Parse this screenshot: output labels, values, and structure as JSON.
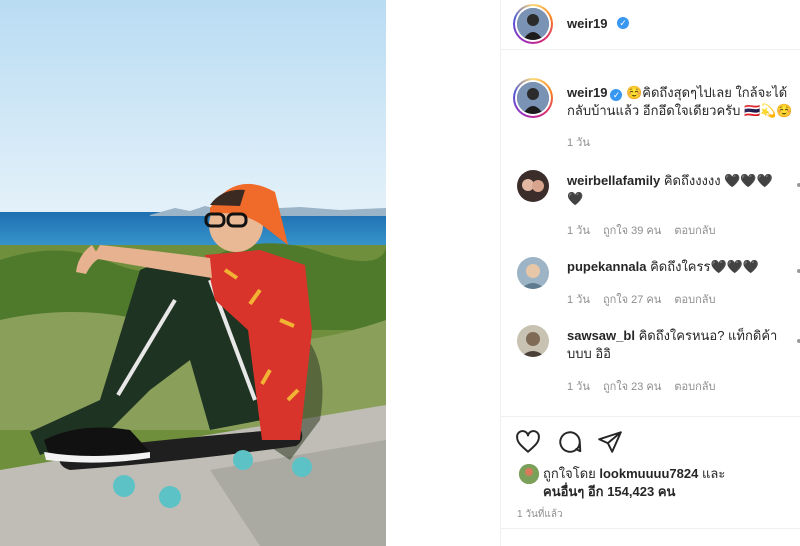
{
  "post": {
    "username": "weir19",
    "verified_icon": "verified-badge-icon"
  },
  "caption": {
    "username": "weir19",
    "text": "☺️คิดถึงสุดๆไปเลย ใกล้จะได้กลับบ้านแล้ว อีกอึดใจเดียวครับ 🇹🇭💫☺️",
    "time": "1 วัน"
  },
  "comments": [
    {
      "username": "weirbellafamily",
      "text": "คิดถึงงงงง 🖤🖤🖤🖤",
      "time": "1 วัน",
      "likes": "ถูกใจ 39 คน",
      "reply": "ตอบกลับ"
    },
    {
      "username": "pupekannala",
      "text": "คิดถึงใครร🖤🖤🖤",
      "time": "1 วัน",
      "likes": "ถูกใจ 27 คน",
      "reply": "ตอบกลับ"
    },
    {
      "username": "sawsaw_bl",
      "text": "คิดถึงใครหนอ? แท็กดิค้าบบบ อิอิ",
      "time": "1 วัน",
      "likes": "ถูกใจ 23 คน",
      "reply": "ตอบกลับ"
    }
  ],
  "actions": {
    "like_icon": "heart-icon",
    "comment_icon": "comment-icon",
    "share_icon": "share-icon"
  },
  "likes": {
    "prefix": "ถูกใจโดย",
    "user": "lookmuuuu7824",
    "and": "และ",
    "others_label": "คนอื่นๆ อีก",
    "count": "154,423",
    "unit": "คน"
  },
  "posted_ago": "1 วันที่แล้ว",
  "colors": {
    "verified": "#3897f0",
    "text": "#262626",
    "muted": "#8e8e8e",
    "border": "#efefef"
  }
}
